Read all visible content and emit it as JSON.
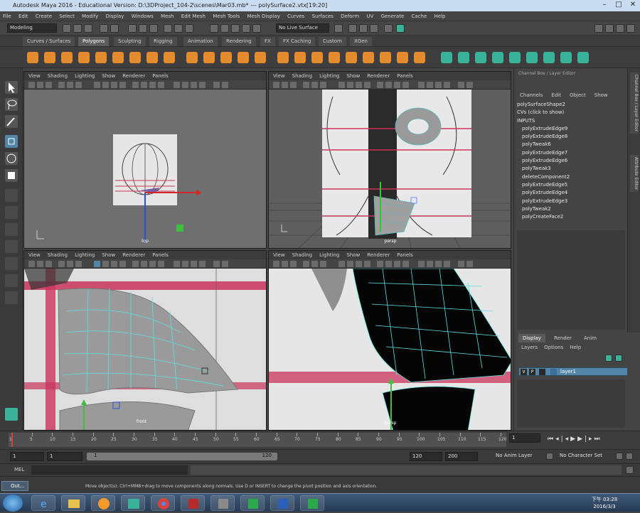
{
  "window": {
    "title": "Autodesk Maya 2016 - Educational Version: D:\\3DProject_104-2\\scenes\\Mar03.mb* --- polySurface2.vtx[19:20]",
    "controls": [
      "–",
      "□",
      "✕"
    ]
  },
  "menubar": [
    "File",
    "Edit",
    "Create",
    "Select",
    "Modify",
    "Display",
    "Windows",
    "Mesh",
    "Edit Mesh",
    "Mesh Tools",
    "Mesh Display",
    "Curves",
    "Surfaces",
    "Deform",
    "UV",
    "Generate",
    "Cache",
    "Help"
  ],
  "status": {
    "mode_dropdown": "Modeling",
    "live_surface": "No Live Surface"
  },
  "shelf_tabs": [
    "Curves / Surfaces",
    "Polygons",
    "Sculpting",
    "Rigging",
    "Animation",
    "Rendering",
    "FX",
    "FX Caching",
    "Custom",
    "XGen"
  ],
  "shelf_active": "Polygons",
  "panel_menu": [
    "View",
    "Shading",
    "Lighting",
    "Show",
    "Renderer",
    "Panels"
  ],
  "viewports": {
    "top_left_camera": "top",
    "top_right_camera": "persp",
    "bottom_left_camera": "front",
    "bottom_right_camera": "persp"
  },
  "channel_box": {
    "header": "Channel Box / Layer Editor",
    "menu": [
      "Channels",
      "Edit",
      "Object",
      "Show"
    ],
    "shape_name": "polySurfaceShape2",
    "cvs_label": "CVs (click to show)",
    "inputs_label": "INPUTS",
    "inputs": [
      "polyExtrudeEdge9",
      "polyExtrudeEdge8",
      "polyTweak6",
      "polyExtrudeEdge7",
      "polyExtrudeEdge6",
      "polyTweak3",
      "deleteComponent2",
      "polyExtrudeEdge5",
      "polyExtrudeEdge4",
      "polyExtrudeEdge3",
      "polyTweak2",
      "polyCreateFace2"
    ],
    "side_tabs": [
      "Channel Box / Layer Editor",
      "Attribute Editor"
    ]
  },
  "layer_editor": {
    "tabs": [
      "Display",
      "Render",
      "Anim"
    ],
    "active_tab": "Display",
    "menu": [
      "Layers",
      "Options",
      "Help"
    ],
    "layer": {
      "v": "V",
      "p": "P",
      "name": "layer1"
    }
  },
  "timeline": {
    "ticks": [
      "1",
      "5",
      "10",
      "15",
      "20",
      "25",
      "30",
      "35",
      "40",
      "45",
      "50",
      "55",
      "60",
      "65",
      "70",
      "75",
      "80",
      "85",
      "90",
      "95",
      "100",
      "105",
      "110",
      "115",
      "120"
    ],
    "current_frame": "1"
  },
  "range": {
    "start": "1",
    "playback_start": "1",
    "slider_start": "1",
    "slider_end": "120",
    "playback_end": "120",
    "end": "200",
    "anim_layer": "No Anim Layer",
    "character_set": "No Character Set"
  },
  "command_line": {
    "label": "MEL"
  },
  "help_line": "Move object(s): Ctrl+MMB+drag to move components along normals. Use D or INSERT to change the pivot position and axis orientation.",
  "taskbar": {
    "left_item": "Out...",
    "clock_time": "下午 03:28",
    "clock_date": "2016/3/3"
  },
  "colors": {
    "accent_blue": "#5285a6",
    "shelf_teal": "#3bb39a",
    "shelf_orange": "#e68a2e",
    "reference_red": "#c9345c"
  }
}
